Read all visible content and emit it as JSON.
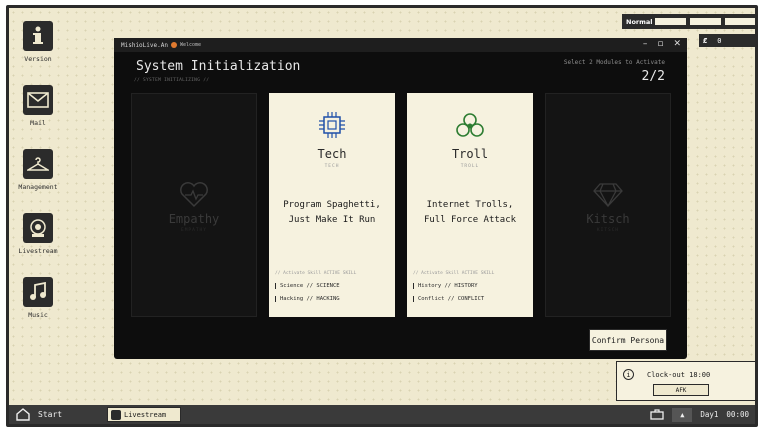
{
  "desktop": {
    "icons": [
      {
        "label": "Version",
        "icon": "info-icon"
      },
      {
        "label": "Mail",
        "icon": "mail-icon"
      },
      {
        "label": "Management",
        "icon": "hanger-icon"
      },
      {
        "label": "Livestream",
        "icon": "webcam-icon"
      },
      {
        "label": "Music",
        "icon": "music-note-icon"
      }
    ]
  },
  "topbar": {
    "mode_label": "Normal",
    "currency_value": "0"
  },
  "window": {
    "title": "MishioLive.An",
    "subtitle": "Welcome",
    "heading": "System Initialization",
    "subheading": "// SYSTEM INITIALIZING //",
    "select_hint": "Select 2 Modules to Activate",
    "select_count": "2/2",
    "confirm_label": "Confirm Persona"
  },
  "modules": [
    {
      "name": "Empathy",
      "code": "EMPATHY",
      "selected": false,
      "icon": "heart-pulse-icon"
    },
    {
      "name": "Tech",
      "code": "TECH",
      "selected": true,
      "icon": "chip-icon",
      "desc": "Program Spaghetti, Just Make It Run",
      "skill_header": "// Activate Skill ACTIVE SKILL",
      "skills": [
        "Science // SCIENCE",
        "Hacking // HACKING"
      ]
    },
    {
      "name": "Troll",
      "code": "TROLL",
      "selected": true,
      "icon": "biohazard-icon",
      "desc": "Internet Trolls, Full Force Attack",
      "skill_header": "// Activate Skill ACTIVE SKILL",
      "skills": [
        "History // HISTORY",
        "Conflict // CONFLICT"
      ]
    },
    {
      "name": "Kitsch",
      "code": "KITSCH",
      "selected": false,
      "icon": "diamond-icon"
    }
  ],
  "notification": {
    "message": "Clock-out 18:00",
    "button_label": "AFK"
  },
  "taskbar": {
    "start_label": "Start",
    "task_label": "Livestream",
    "day_label": "Day1",
    "time": "00:00"
  },
  "colors": {
    "accent_green": "#2e7d32",
    "accent_blue": "#1f4fa8",
    "notify_orange": "#e07a2f"
  }
}
